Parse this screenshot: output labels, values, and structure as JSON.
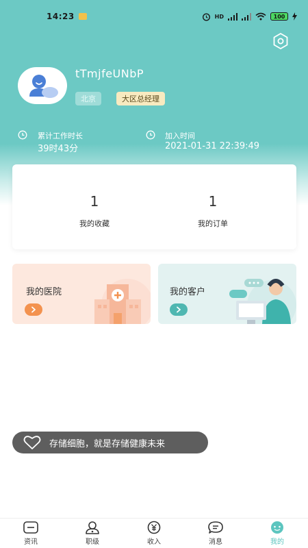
{
  "status_bar": {
    "time": "14:23",
    "signal_label": "HD",
    "battery": "100"
  },
  "profile": {
    "username": "tTmjfeUNbP",
    "city": "北京",
    "role": "大区总经理"
  },
  "stats": {
    "work_time_label": "累计工作时长",
    "work_time_value": "39时43分",
    "join_label": "加入时间",
    "join_value": "2021-01-31 22:39:49"
  },
  "counts": [
    {
      "value": "1",
      "label": "我的收藏"
    },
    {
      "value": "1",
      "label": "我的订单"
    }
  ],
  "features": {
    "hospital": {
      "title": "我的医院",
      "color": "#fde8de",
      "arrow_color": "#f3924f"
    },
    "customer": {
      "title": "我的客户",
      "color": "#e3f2f1",
      "arrow_color": "#4fb7b1"
    }
  },
  "toast": {
    "text": "存储细胞，就是存储健康未来"
  },
  "nav": [
    {
      "label": "资讯",
      "icon": "news-icon"
    },
    {
      "label": "职级",
      "icon": "rank-icon"
    },
    {
      "label": "收入",
      "icon": "income-icon"
    },
    {
      "label": "消息",
      "icon": "message-icon"
    },
    {
      "label": "我的",
      "icon": "profile-icon",
      "active": true
    }
  ],
  "colors": {
    "accent": "#6cc9c4",
    "tag_role_bg": "#f8eac0"
  }
}
